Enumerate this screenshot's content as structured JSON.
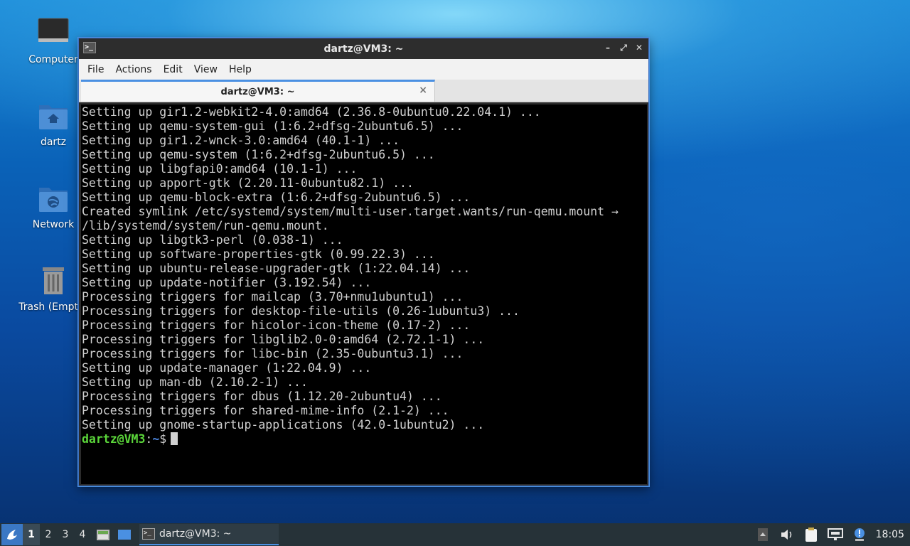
{
  "desktop": {
    "icons": [
      {
        "label": "Computer"
      },
      {
        "label": "dartz"
      },
      {
        "label": "Network"
      },
      {
        "label": "Trash (Empty)"
      }
    ]
  },
  "window": {
    "title": "dartz@VM3: ~",
    "menu": [
      "File",
      "Actions",
      "Edit",
      "View",
      "Help"
    ],
    "tab_label": "dartz@VM3: ~",
    "tab_close": "×",
    "controls": {
      "minimize": "–",
      "maximize": "⤢",
      "close": "✕"
    }
  },
  "terminal": {
    "lines": [
      "Setting up gir1.2-webkit2-4.0:amd64 (2.36.8-0ubuntu0.22.04.1) ...",
      "Setting up qemu-system-gui (1:6.2+dfsg-2ubuntu6.5) ...",
      "Setting up gir1.2-wnck-3.0:amd64 (40.1-1) ...",
      "Setting up qemu-system (1:6.2+dfsg-2ubuntu6.5) ...",
      "Setting up libgfapi0:amd64 (10.1-1) ...",
      "Setting up apport-gtk (2.20.11-0ubuntu82.1) ...",
      "Setting up qemu-block-extra (1:6.2+dfsg-2ubuntu6.5) ...",
      "Created symlink /etc/systemd/system/multi-user.target.wants/run-qemu.mount →",
      "/lib/systemd/system/run-qemu.mount.",
      "Setting up libgtk3-perl (0.038-1) ...",
      "Setting up software-properties-gtk (0.99.22.3) ...",
      "Setting up ubuntu-release-upgrader-gtk (1:22.04.14) ...",
      "Setting up update-notifier (3.192.54) ...",
      "Processing triggers for mailcap (3.70+nmu1ubuntu1) ...",
      "Processing triggers for desktop-file-utils (0.26-1ubuntu3) ...",
      "Processing triggers for hicolor-icon-theme (0.17-2) ...",
      "Processing triggers for libglib2.0-0:amd64 (2.72.1-1) ...",
      "Processing triggers for libc-bin (2.35-0ubuntu3.1) ...",
      "Setting up update-manager (1:22.04.9) ...",
      "Setting up man-db (2.10.2-1) ...",
      "Processing triggers for dbus (1.12.20-2ubuntu4) ...",
      "Processing triggers for shared-mime-info (2.1-2) ...",
      "Setting up gnome-startup-applications (42.0-1ubuntu2) ..."
    ],
    "prompt": {
      "user_host": "dartz@VM3",
      "sep": ":",
      "path": "~",
      "symbol": "$"
    }
  },
  "taskbar": {
    "workspaces": [
      "1",
      "2",
      "3",
      "4"
    ],
    "active_workspace": "1",
    "task_label": "dartz@VM3: ~",
    "clock": "18:05"
  },
  "colors": {
    "accent": "#4a90e2",
    "prompt_user": "#5bd63a",
    "prompt_path": "#4f8ae6"
  }
}
